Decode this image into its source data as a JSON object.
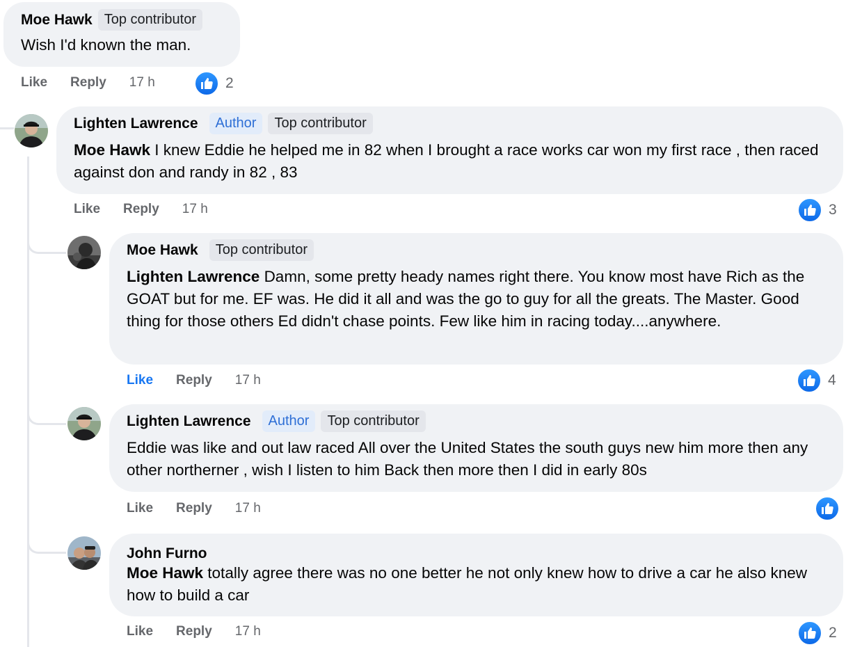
{
  "comments": [
    {
      "author": "Moe Hawk",
      "badges": [
        "Top contributor"
      ],
      "text": "Wish I'd known the man.",
      "actions": {
        "like": "Like",
        "reply": "Reply",
        "time": "17 h"
      },
      "reactions": {
        "icon": "like-icon",
        "count": "2"
      },
      "replies": [
        {
          "author": "Lighten Lawrence",
          "badges": [
            "Author",
            "Top contributor"
          ],
          "mention": "Moe Hawk",
          "text": "I knew Eddie he helped me in 82 when I brought a race works car won my first race , then raced against don and randy in 82 , 83",
          "actions": {
            "like": "Like",
            "reply": "Reply",
            "time": "17 h"
          },
          "reactions": {
            "icon": "like-icon",
            "count": "3"
          }
        },
        {
          "author": "Moe Hawk",
          "badges": [
            "Top contributor"
          ],
          "mention": "Lighten Lawrence",
          "text": "Damn, some pretty heady names right there. You know most have Rich as the GOAT but for me. EF was. He did it all and was the go to guy for all the greats. The Master. Good thing for those others Ed didn't chase points. Few like him in racing today....anywhere.",
          "actions": {
            "like": "Like",
            "reply": "Reply",
            "time": "17 h",
            "liked": true
          },
          "reactions": {
            "icon": "like-icon",
            "count": "4"
          }
        },
        {
          "author": "Lighten Lawrence",
          "badges": [
            "Author",
            "Top contributor"
          ],
          "text": "Eddie was like and out law raced All over the United States the south guys new him more then any other northerner , wish I listen to him Back then more then I did in early 80s",
          "actions": {
            "like": "Like",
            "reply": "Reply",
            "time": "17 h"
          },
          "reactions": {
            "icon": "like-icon",
            "count": ""
          }
        },
        {
          "author": "John Furno",
          "badges": [],
          "mention": "Moe Hawk",
          "text": "totally agree there was no one better he not only knew how to drive a car he also knew how to build a car",
          "actions": {
            "like": "Like",
            "reply": "Reply",
            "time": "17 h"
          },
          "reactions": {
            "icon": "like-icon",
            "count": "2"
          }
        }
      ]
    }
  ],
  "colors": {
    "like_blue": "#1877f2",
    "bubble_bg": "#f0f2f5",
    "meta_gray": "#65676b",
    "author_badge_text": "#2e6fd6"
  }
}
